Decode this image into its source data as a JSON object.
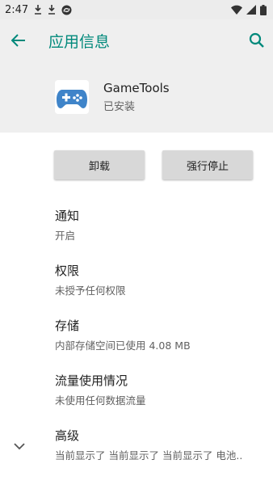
{
  "status_bar": {
    "time": "2:47"
  },
  "app_bar": {
    "title": "应用信息"
  },
  "app": {
    "name": "GameTools",
    "install_status": "已安装"
  },
  "actions": {
    "uninstall": "卸载",
    "force_stop": "强行停止"
  },
  "items": [
    {
      "title": "通知",
      "subtitle": "开启"
    },
    {
      "title": "权限",
      "subtitle": "未授予任何权限"
    },
    {
      "title": "存储",
      "subtitle": "内部存储空间已使用 4.08 MB"
    },
    {
      "title": "流量使用情况",
      "subtitle": "未使用任何数据流量"
    },
    {
      "title": "高级",
      "subtitle": "当前显示了 当前显示了 当前显示了 电池.."
    }
  ],
  "colors": {
    "accent": "#00897b",
    "header_bg": "#efefef"
  },
  "icons": [
    "download-icon",
    "download-icon",
    "sync-off-icon",
    "wifi-icon",
    "signal-icon",
    "battery-icon",
    "back-arrow-icon",
    "search-icon",
    "gamepad-icon",
    "chevron-down-icon"
  ]
}
